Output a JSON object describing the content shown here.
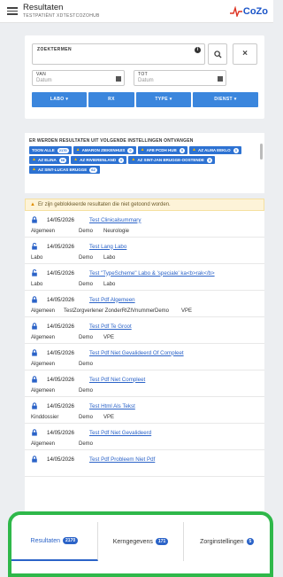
{
  "header": {
    "title": "Resultaten",
    "subtitle": "TESTPATIËNT XDTESTCOZOHUB",
    "logo_text": "CoZo"
  },
  "filters": {
    "search_placeholder": "ZOEKTERMEN",
    "from_label": "VAN",
    "from_placeholder": "Datum",
    "to_label": "TOT",
    "to_placeholder": "Datum",
    "buttons": [
      "LABO ▾",
      "RX",
      "TYPE ▾",
      "DIENST ▾"
    ]
  },
  "institutions": {
    "title": "ER WERDEN RESULTATEN UIT VOLGENDE INSTELLINGEN ONTVANGEN",
    "chips": [
      {
        "label": "TOON ALLE",
        "count": "2170",
        "warn": false
      },
      {
        "label": "AMARON ZIEKENHUIS",
        "count": "0",
        "warn": true
      },
      {
        "label": "AFB PCDH HUB",
        "count": "0",
        "warn": true
      },
      {
        "label": "AZ ALMA EEKLO",
        "count": "3",
        "warn": true
      },
      {
        "label": "AZ ELINA",
        "count": "68",
        "warn": true
      },
      {
        "label": "AZ RIVIERENLAND",
        "count": "0",
        "warn": true
      },
      {
        "label": "AZ SINT-JAN BRUGGE-OOSTENDE",
        "count": "3",
        "warn": true
      },
      {
        "label": "AZ SINT-LUCAS BRUGGE",
        "count": "62",
        "warn": true
      }
    ]
  },
  "warning": "Er zijn geblokkeerde resultaten die niet getoond worden.",
  "results": [
    {
      "locked": true,
      "date": "14/05/2026",
      "title": "Test Clinicalsummary",
      "cols": [
        "Algemeen",
        "Demo",
        "Neurologie"
      ]
    },
    {
      "locked": false,
      "date": "14/05/2026",
      "title": "Test Lang Labo",
      "cols": [
        "Labo",
        "Demo",
        "Labo"
      ]
    },
    {
      "locked": false,
      "date": "14/05/2026",
      "title": "Test \"TypeScheme\" Labo & 'speciale' ka<b>rak</b>",
      "cols": [
        "Labo",
        "Demo",
        "Labo"
      ]
    },
    {
      "locked": true,
      "date": "14/05/2026",
      "title": "Test Pdf Algemeen",
      "cols": [
        "Algemeen",
        "TestZorgverlener ZonderRIZIVnummer",
        "Demo",
        "VPE"
      ]
    },
    {
      "locked": true,
      "date": "14/05/2026",
      "title": "Test Pdf Te Groot",
      "cols": [
        "Algemeen",
        "Demo",
        "VPE"
      ]
    },
    {
      "locked": true,
      "date": "14/05/2026",
      "title": "Test Pdf Niet Gevalideerd Of Compleet",
      "cols": [
        "Algemeen",
        "Demo"
      ]
    },
    {
      "locked": true,
      "date": "14/05/2026",
      "title": "Test Pdf Niet Compleet",
      "cols": [
        "Algemeen",
        "Demo"
      ]
    },
    {
      "locked": true,
      "date": "14/05/2026",
      "title": "Test Html Als Tekst",
      "cols": [
        "Kinddossier",
        "Demo",
        "VPE"
      ]
    },
    {
      "locked": true,
      "date": "14/05/2026",
      "title": "Test Pdf Niet Gevalideerd",
      "cols": [
        "Algemeen",
        "Demo"
      ]
    },
    {
      "locked": true,
      "date": "14/05/2026",
      "title": "Test Pdf Probleem Niet Pdf",
      "cols": []
    }
  ],
  "tabs": [
    {
      "label": "Resultaten",
      "count": "2170",
      "active": true
    },
    {
      "label": "Kerngegevens",
      "count": "171",
      "active": false
    },
    {
      "label": "Zorginstellingen",
      "count": "5",
      "active": false
    }
  ],
  "colors": {
    "accent": "#2b63c8",
    "highlight": "#2fb84a",
    "warning_bg": "#fdf3d8"
  }
}
